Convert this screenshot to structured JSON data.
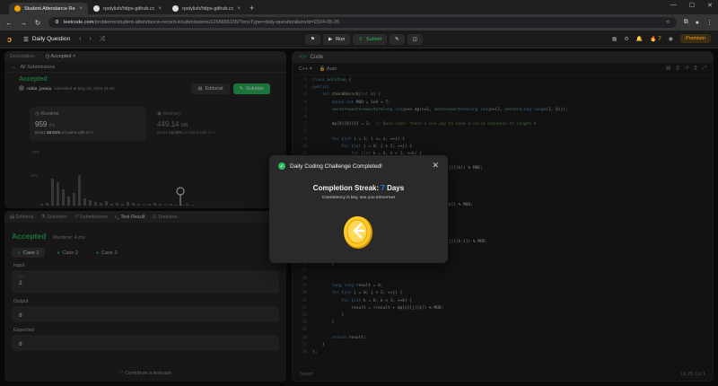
{
  "browser": {
    "tabs": [
      {
        "title": "Student Attendance Record II",
        "active": true
      },
      {
        "title": "rpstylish/https-github.com-rpst",
        "active": false
      },
      {
        "title": "rpstylish/https-github.com-rpst",
        "active": false
      }
    ],
    "url_host": "leetcode.com",
    "url_path": "/problems/student-attendance-record-ii/submissions/1268655155/?envType=daily-question&envId=2024-05-26"
  },
  "lcnav": {
    "daily_label": "Daily Question",
    "run_label": "Run",
    "submit_label": "Submit",
    "streak_count": "7",
    "premium_label": "Premium"
  },
  "left": {
    "tabs": [
      "Description",
      "Accepted"
    ],
    "all_submissions": "All Submissions",
    "status": "Accepted",
    "author": "robin_jsonia",
    "submitted_text": "submitted at May 26, 2024 21:40",
    "editorial_label": "Editorial",
    "solution_label": "Solution",
    "runtime": {
      "label": "Runtime",
      "value": "959",
      "unit": "ms",
      "beats_prefix": "Beats",
      "beats": "40.01%",
      "beats_suffix": "of users with C++"
    },
    "memory": {
      "label": "Memory",
      "value": "449.14",
      "unit": "MB",
      "beats_prefix": "Beats",
      "beats": "10.00%",
      "beats_suffix": "of users with C++"
    },
    "chart_labels": {
      "y_top": "10%",
      "y_mid": "5%"
    }
  },
  "bottom": {
    "tabs": [
      "Editorial",
      "Solutions",
      "Submissions",
      "Test Result",
      "Testcase"
    ],
    "status": "Accepted",
    "runtime_text": "Runtime: 4 ms",
    "cases": [
      "Case 1",
      "Case 2",
      "Case 3"
    ],
    "input_label": "Input",
    "input_var": "n =",
    "input_value": "2",
    "output_label": "Output",
    "output_value": "8",
    "expected_label": "Expected",
    "expected_value": "8",
    "contribute": "Contribute a testcase"
  },
  "editor": {
    "title": "Code",
    "language": "C++",
    "mode": "Auto",
    "saved": "Saved",
    "cursor": "Ln 28, Col 1"
  },
  "modal": {
    "title": "Daily Coding Challenge Completed!",
    "streak_label": "Completion Streak:",
    "streak_value": "7",
    "streak_unit": "Days",
    "note": "Consistency is key, see you tomorrow!"
  },
  "colors": {
    "accent": "#ffa116",
    "success": "#2cbb5d",
    "streak_blue": "#0a84ff"
  }
}
